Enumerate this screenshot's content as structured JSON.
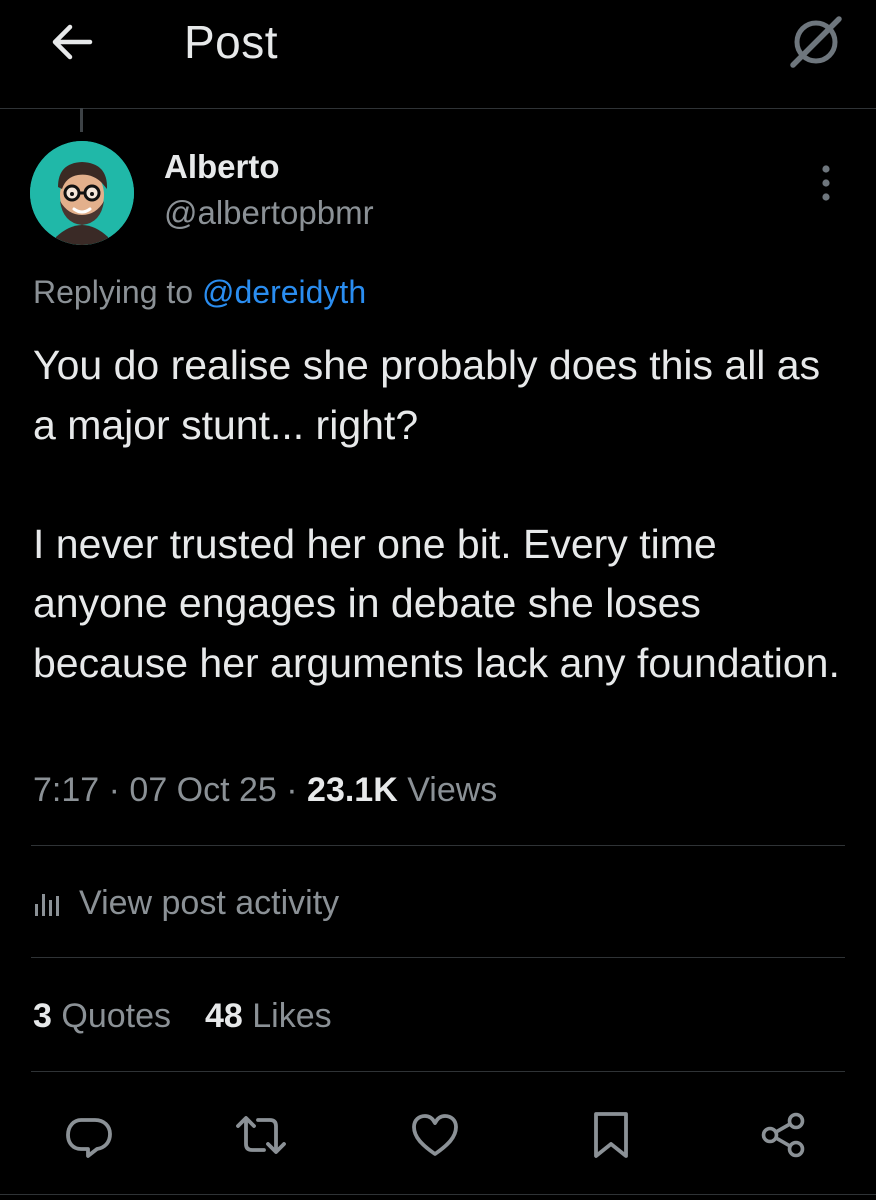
{
  "header": {
    "title": "Post",
    "back_icon": "arrow-left-icon",
    "grok_icon": "grok-icon"
  },
  "author": {
    "name": "Alberto",
    "handle": "@albertopbmr",
    "avatar_color": "#20b8a8"
  },
  "reply": {
    "prefix": "Replying to ",
    "mention": "@dereidyth",
    "mention_color": "#2a8df0"
  },
  "tweet": {
    "paragraphs": [
      "You do realise she probably does this all as a major stunt... right?",
      "I never trusted her one bit. Every time anyone engages in debate she loses because her arguments lack any foundation."
    ]
  },
  "meta": {
    "time": "7:17",
    "separator": " · ",
    "date": "07 Oct 25",
    "views_count": "23.1K",
    "views_label": " Views"
  },
  "activity": {
    "label": "View post activity",
    "icon": "bar-chart-icon"
  },
  "stats": {
    "quotes_count": "3",
    "quotes_label": " Quotes",
    "likes_count": "48",
    "likes_label": " Likes"
  },
  "actions": [
    {
      "name": "reply",
      "icon": "reply-icon"
    },
    {
      "name": "repost",
      "icon": "repost-icon"
    },
    {
      "name": "like",
      "icon": "heart-icon"
    },
    {
      "name": "bookmark",
      "icon": "bookmark-icon"
    },
    {
      "name": "share",
      "icon": "share-icon"
    }
  ],
  "colors": {
    "background": "#000000",
    "text_primary": "#e7e9ea",
    "text_secondary": "#8b9196",
    "divider": "#2f3336",
    "accent": "#2a8df0"
  }
}
